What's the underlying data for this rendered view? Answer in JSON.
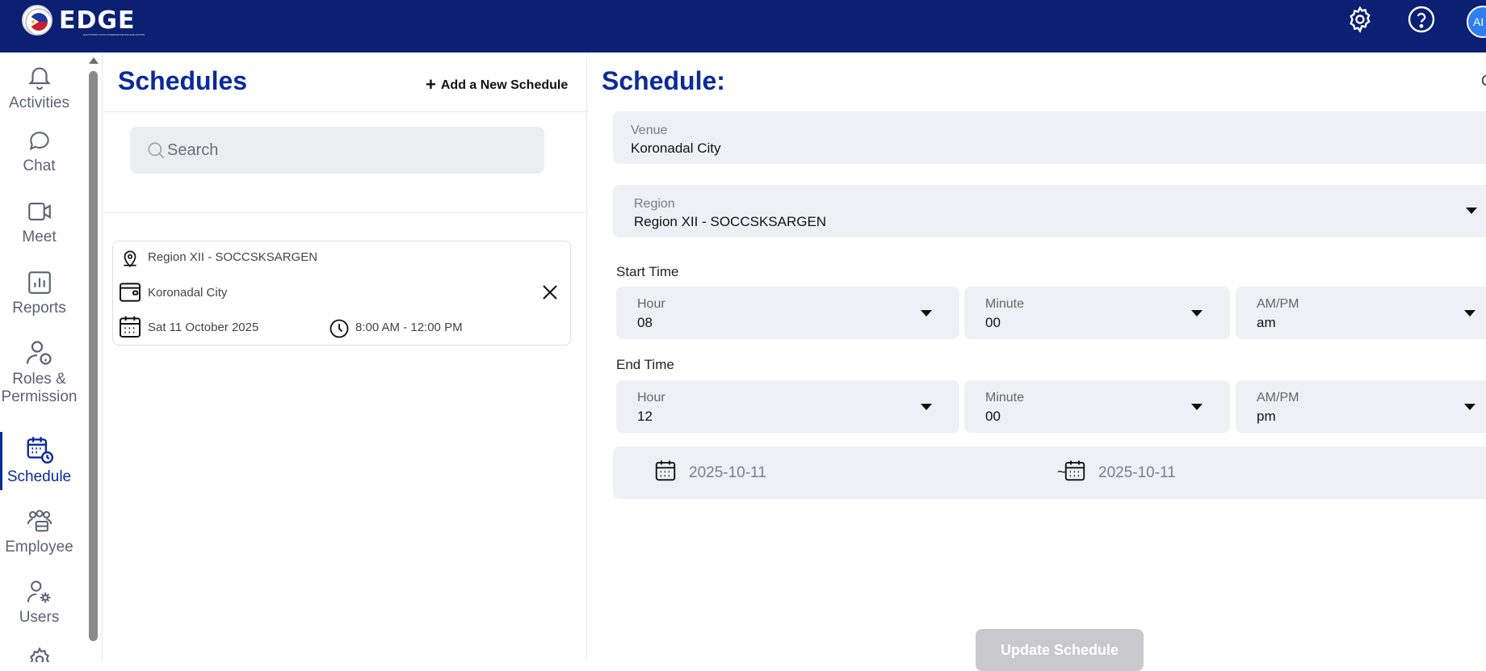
{
  "header": {
    "logo_text": "EDGE",
    "logo_tagline": "ELECTRONIC DATA GOVERNANCE AND EVALUATION",
    "icons": [
      "gear-icon",
      "help-icon"
    ],
    "avatar_initials": "AI"
  },
  "sidebar": {
    "items": [
      {
        "label": "Activities",
        "icon": "bell-icon"
      },
      {
        "label": "Chat",
        "icon": "chat-icon"
      },
      {
        "label": "Meet",
        "icon": "video-icon"
      },
      {
        "label": "Reports",
        "icon": "bar-chart-icon"
      },
      {
        "label": "Roles &",
        "label2": "Permission",
        "icon": "user-info-icon"
      },
      {
        "label": "Schedule",
        "icon": "calendar-clock-icon",
        "active": true
      },
      {
        "label": "Employee",
        "icon": "employees-icon"
      },
      {
        "label": "Users",
        "icon": "user-gear-icon"
      }
    ]
  },
  "list_panel": {
    "title": "Schedules",
    "add_label": "Add a New Schedule",
    "search_placeholder": "Search",
    "schedule_card": {
      "region": "Region XII - SOCCSKSARGEN",
      "venue": "Koronadal City",
      "date": "Sat 11 October 2025",
      "time": "8:00 AM - 12:00 PM"
    }
  },
  "detail": {
    "title": "Schedule:",
    "corner_text": "C",
    "venue": {
      "label": "Venue",
      "value": "Koronadal City"
    },
    "region": {
      "label": "Region",
      "value": "Region XII - SOCCSKSARGEN"
    },
    "start_time": {
      "label": "Start Time",
      "hour": {
        "label": "Hour",
        "value": "08"
      },
      "minute": {
        "label": "Minute",
        "value": "00"
      },
      "ampm": {
        "label": "AM/PM",
        "value": "am"
      }
    },
    "end_time": {
      "label": "End Time",
      "hour": {
        "label": "Hour",
        "value": "12"
      },
      "minute": {
        "label": "Minute",
        "value": "00"
      },
      "ampm": {
        "label": "AM/PM",
        "value": "pm"
      }
    },
    "date_range": {
      "start": "2025-10-11",
      "separator": "~",
      "end": "2025-10-11"
    },
    "update_button": "Update Schedule"
  },
  "colors": {
    "header_bg": "#0b1f73",
    "title_blue": "#0b2a9b",
    "field_bg": "#eef0f5",
    "button_disabled": "#c9c9cc"
  }
}
